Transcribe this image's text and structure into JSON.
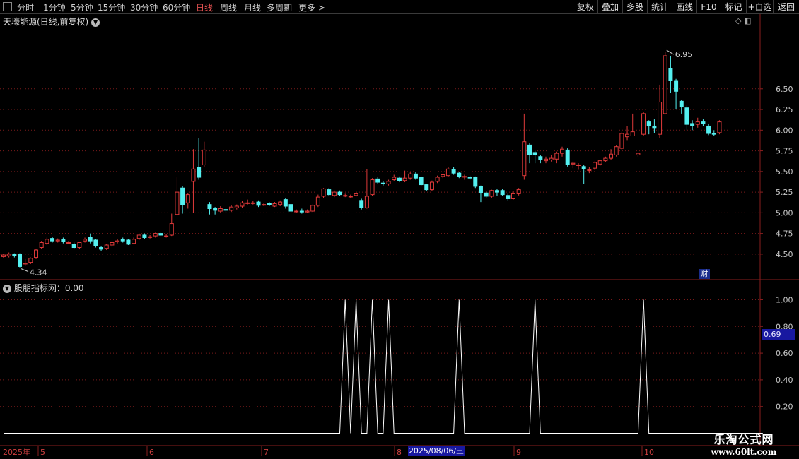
{
  "toolbar": {
    "periods": [
      "分时",
      "1分钟",
      "5分钟",
      "15分钟",
      "30分钟",
      "60分钟",
      "日线",
      "周线",
      "月线",
      "多周期",
      "更多 >"
    ],
    "active_period": "日线",
    "right_buttons": [
      "复权",
      "叠加",
      "多股",
      "统计",
      "画线",
      "F10",
      "标记",
      "+自选",
      "返回"
    ]
  },
  "price_panel": {
    "title": "天壕能源(日线,前复权)",
    "high_label": "6.95",
    "low_label": "4.34",
    "badge": "财"
  },
  "indicator_panel": {
    "title": "股朋指标网：0.00",
    "current_value": "0.69"
  },
  "x_axis": {
    "year_label": "2025年",
    "month_labels": [
      "5",
      "6",
      "7",
      "8",
      "9",
      "10"
    ],
    "cursor_date": "2025/08/06/三"
  },
  "watermark": {
    "line1": "乐淘公式网",
    "line2": "www.60lt.com"
  },
  "colors": {
    "up": "#e03a3a",
    "down": "#54f0f0",
    "grid": "#7a1a1a",
    "axis": "#8a1e1e",
    "indicator": "#ffffff"
  },
  "chart_data": [
    {
      "type": "candlestick",
      "title": "天壕能源(日线,前复权)",
      "ylim": [
        4.2,
        7.25
      ],
      "yticks": [
        "6.50",
        "6.25",
        "6.00",
        "5.75",
        "5.50",
        "5.25",
        "5.00",
        "4.75",
        "4.50"
      ],
      "annotations": [
        {
          "text": "6.95",
          "at": "max high"
        },
        {
          "text": "4.34",
          "at": "min low"
        }
      ],
      "candles": [
        [
          4.47,
          4.49,
          4.5,
          4.45
        ],
        [
          4.48,
          4.5,
          4.52,
          4.46
        ],
        [
          4.5,
          4.48,
          4.51,
          4.46
        ],
        [
          4.5,
          4.35,
          4.51,
          4.34
        ],
        [
          4.38,
          4.39,
          4.44,
          4.36
        ],
        [
          4.4,
          4.45,
          4.46,
          4.38
        ],
        [
          4.46,
          4.55,
          4.56,
          4.44
        ],
        [
          4.58,
          4.64,
          4.66,
          4.56
        ],
        [
          4.63,
          4.68,
          4.7,
          4.61
        ],
        [
          4.69,
          4.66,
          4.71,
          4.64
        ],
        [
          4.66,
          4.67,
          4.69,
          4.64
        ],
        [
          4.68,
          4.65,
          4.7,
          4.63
        ],
        [
          4.64,
          4.64,
          4.66,
          4.62
        ],
        [
          4.62,
          4.58,
          4.64,
          4.57
        ],
        [
          4.58,
          4.64,
          4.65,
          4.56
        ],
        [
          4.66,
          4.68,
          4.7,
          4.64
        ],
        [
          4.7,
          4.66,
          4.75,
          4.63
        ],
        [
          4.67,
          4.6,
          4.68,
          4.58
        ],
        [
          4.58,
          4.56,
          4.6,
          4.54
        ],
        [
          4.57,
          4.61,
          4.62,
          4.55
        ],
        [
          4.61,
          4.64,
          4.65,
          4.59
        ],
        [
          4.65,
          4.66,
          4.68,
          4.63
        ],
        [
          4.68,
          4.66,
          4.7,
          4.64
        ],
        [
          4.67,
          4.62,
          4.68,
          4.61
        ],
        [
          4.63,
          4.68,
          4.7,
          4.62
        ],
        [
          4.69,
          4.73,
          4.75,
          4.67
        ],
        [
          4.73,
          4.7,
          4.75,
          4.68
        ],
        [
          4.71,
          4.71,
          4.73,
          4.69
        ],
        [
          4.72,
          4.75,
          4.76,
          4.7
        ],
        [
          4.75,
          4.73,
          4.77,
          4.72
        ],
        [
          4.72,
          4.72,
          4.74,
          4.7
        ],
        [
          4.73,
          4.87,
          4.99,
          4.72
        ],
        [
          4.98,
          5.25,
          5.43,
          4.97
        ],
        [
          5.3,
          5.1,
          5.32,
          4.99
        ],
        [
          5.12,
          5.22,
          5.24,
          5.05
        ],
        [
          5.38,
          5.53,
          5.77,
          5.0
        ],
        [
          5.55,
          5.43,
          5.9,
          5.4
        ],
        [
          5.58,
          5.76,
          5.86,
          5.55
        ],
        [
          5.1,
          5.05,
          5.13,
          4.98
        ],
        [
          5.05,
          5.03,
          5.07,
          4.98
        ],
        [
          5.02,
          5.05,
          5.08,
          5.0
        ],
        [
          5.04,
          5.03,
          5.06,
          5.0
        ],
        [
          5.03,
          5.07,
          5.09,
          5.01
        ],
        [
          5.06,
          5.08,
          5.1,
          5.04
        ],
        [
          5.08,
          5.12,
          5.14,
          5.06
        ],
        [
          5.12,
          5.12,
          5.16,
          5.1
        ],
        [
          5.12,
          5.12,
          5.14,
          5.1
        ],
        [
          5.13,
          5.09,
          5.15,
          5.07
        ],
        [
          5.1,
          5.1,
          5.12,
          5.08
        ],
        [
          5.11,
          5.1,
          5.13,
          5.08
        ],
        [
          5.08,
          5.11,
          5.13,
          5.07
        ],
        [
          5.1,
          5.13,
          5.15,
          5.08
        ],
        [
          5.16,
          5.08,
          5.18,
          5.05
        ],
        [
          5.1,
          5.02,
          5.12,
          5.0
        ],
        [
          5.02,
          5.02,
          5.04,
          5.0
        ],
        [
          5.02,
          5.01,
          5.05,
          4.99
        ],
        [
          5.01,
          5.02,
          5.04,
          5.0
        ],
        [
          5.02,
          5.09,
          5.1,
          5.01
        ],
        [
          5.09,
          5.19,
          5.22,
          5.07
        ],
        [
          5.2,
          5.29,
          5.3,
          5.18
        ],
        [
          5.28,
          5.22,
          5.3,
          5.2
        ],
        [
          5.21,
          5.25,
          5.27,
          5.19
        ],
        [
          5.25,
          5.22,
          5.27,
          5.2
        ],
        [
          5.21,
          5.21,
          5.23,
          5.19
        ],
        [
          5.2,
          5.2,
          5.22,
          5.18
        ],
        [
          5.21,
          5.23,
          5.25,
          5.19
        ],
        [
          5.15,
          5.06,
          5.17,
          5.04
        ],
        [
          5.06,
          5.2,
          5.53,
          5.05
        ],
        [
          5.22,
          5.4,
          5.42,
          5.2
        ],
        [
          5.41,
          5.37,
          5.43,
          5.35
        ],
        [
          5.36,
          5.35,
          5.38,
          5.33
        ],
        [
          5.35,
          5.38,
          5.4,
          5.33
        ],
        [
          5.4,
          5.43,
          5.46,
          5.38
        ],
        [
          5.42,
          5.39,
          5.44,
          5.37
        ],
        [
          5.39,
          5.42,
          5.51,
          5.37
        ],
        [
          5.42,
          5.47,
          5.49,
          5.4
        ],
        [
          5.47,
          5.42,
          5.49,
          5.4
        ],
        [
          5.43,
          5.34,
          5.44,
          5.32
        ],
        [
          5.34,
          5.28,
          5.35,
          5.26
        ],
        [
          5.28,
          5.37,
          5.39,
          5.26
        ],
        [
          5.38,
          5.43,
          5.45,
          5.36
        ],
        [
          5.44,
          5.46,
          5.47,
          5.42
        ],
        [
          5.45,
          5.53,
          5.55,
          5.43
        ],
        [
          5.52,
          5.48,
          5.55,
          5.46
        ],
        [
          5.48,
          5.44,
          5.49,
          5.42
        ],
        [
          5.44,
          5.44,
          5.46,
          5.4
        ],
        [
          5.43,
          5.42,
          5.45,
          5.4
        ],
        [
          5.43,
          5.32,
          5.44,
          5.3
        ],
        [
          5.32,
          5.24,
          5.33,
          5.13
        ],
        [
          5.24,
          5.2,
          5.26,
          5.18
        ],
        [
          5.2,
          5.27,
          5.28,
          5.18
        ],
        [
          5.27,
          5.25,
          5.29,
          5.2
        ],
        [
          5.27,
          5.22,
          5.29,
          5.2
        ],
        [
          5.21,
          5.17,
          5.23,
          5.15
        ],
        [
          5.17,
          5.23,
          5.26,
          5.16
        ],
        [
          5.23,
          5.28,
          5.3,
          5.21
        ],
        [
          5.45,
          5.86,
          6.2,
          5.4
        ],
        [
          5.82,
          5.7,
          5.84,
          5.6
        ],
        [
          5.73,
          5.7,
          5.75,
          5.6
        ],
        [
          5.68,
          5.64,
          5.7,
          5.6
        ],
        [
          5.63,
          5.65,
          5.68,
          5.6
        ],
        [
          5.64,
          5.66,
          5.7,
          5.62
        ],
        [
          5.65,
          5.72,
          5.74,
          5.6
        ],
        [
          5.72,
          5.77,
          5.8,
          5.68
        ],
        [
          5.76,
          5.58,
          5.78,
          5.56
        ],
        [
          5.59,
          5.6,
          5.62,
          5.54
        ],
        [
          5.58,
          5.58,
          5.6,
          5.52
        ],
        [
          5.56,
          5.53,
          5.58,
          5.35
        ],
        [
          5.52,
          5.52,
          5.55,
          5.48
        ],
        [
          5.54,
          5.61,
          5.62,
          5.52
        ],
        [
          5.59,
          5.63,
          5.64,
          5.57
        ],
        [
          5.63,
          5.66,
          5.68,
          5.61
        ],
        [
          5.66,
          5.71,
          5.77,
          5.64
        ],
        [
          5.7,
          5.8,
          5.82,
          5.68
        ],
        [
          5.78,
          5.96,
          5.98,
          5.76
        ],
        [
          5.92,
          5.95,
          6.05,
          5.88
        ],
        [
          5.93,
          5.98,
          6.2,
          5.93
        ],
        [
          5.7,
          5.72,
          5.73,
          5.68
        ],
        [
          5.95,
          6.2,
          6.22,
          5.93
        ],
        [
          6.1,
          6.05,
          6.12,
          5.95
        ],
        [
          6.05,
          6.03,
          6.13,
          5.96
        ],
        [
          5.95,
          6.34,
          6.55,
          5.9
        ],
        [
          6.2,
          6.9,
          6.95,
          6.2
        ],
        [
          6.75,
          6.6,
          6.9,
          6.45
        ],
        [
          6.6,
          6.47,
          6.62,
          6.25
        ],
        [
          6.35,
          6.28,
          6.37,
          6.2
        ],
        [
          6.27,
          6.07,
          6.3,
          6.0
        ],
        [
          6.08,
          6.05,
          6.12,
          6.0
        ],
        [
          6.07,
          6.1,
          6.15,
          6.03
        ],
        [
          6.1,
          6.08,
          6.13,
          6.05
        ],
        [
          6.05,
          5.96,
          6.08,
          5.94
        ],
        [
          5.96,
          5.95,
          6.0,
          5.93
        ],
        [
          5.97,
          6.1,
          6.12,
          5.95
        ]
      ]
    },
    {
      "type": "line",
      "title": "股朋指标网",
      "series": [
        {
          "values": [
            0,
            0,
            0,
            0,
            0,
            0,
            0,
            0,
            0,
            0,
            0,
            0,
            0,
            0,
            0,
            0,
            0,
            0,
            0,
            0,
            0,
            0,
            0,
            0,
            0,
            0,
            0,
            0,
            0,
            0,
            0,
            0,
            0,
            0,
            0,
            0,
            0,
            0,
            0,
            0,
            0,
            0,
            0,
            0,
            0,
            0,
            0,
            0,
            0,
            0,
            0,
            0,
            0,
            0,
            0,
            0,
            0,
            0,
            0,
            0,
            0,
            0,
            0,
            1,
            0,
            1,
            0,
            0,
            1,
            0,
            0,
            1,
            0,
            0,
            0,
            0,
            0,
            0,
            0,
            0,
            0,
            0,
            0,
            0,
            1,
            0,
            0,
            0,
            0,
            0,
            0,
            0,
            0,
            0,
            0,
            0,
            0,
            0,
            1,
            0,
            0,
            0,
            0,
            0,
            0,
            0,
            0,
            0,
            0,
            0,
            0,
            0,
            0,
            0,
            0,
            0,
            0,
            0,
            1,
            0,
            0,
            0,
            0,
            0,
            0,
            0,
            0,
            0,
            0,
            0,
            0,
            0,
            0,
            0,
            0,
            0,
            0,
            0,
            0,
            0,
            0
          ]
        }
      ],
      "ylim": [
        -0.05,
        1.05
      ],
      "yticks": [
        "1.00",
        "0.80",
        "0.60",
        "0.40",
        "0.20"
      ]
    }
  ]
}
